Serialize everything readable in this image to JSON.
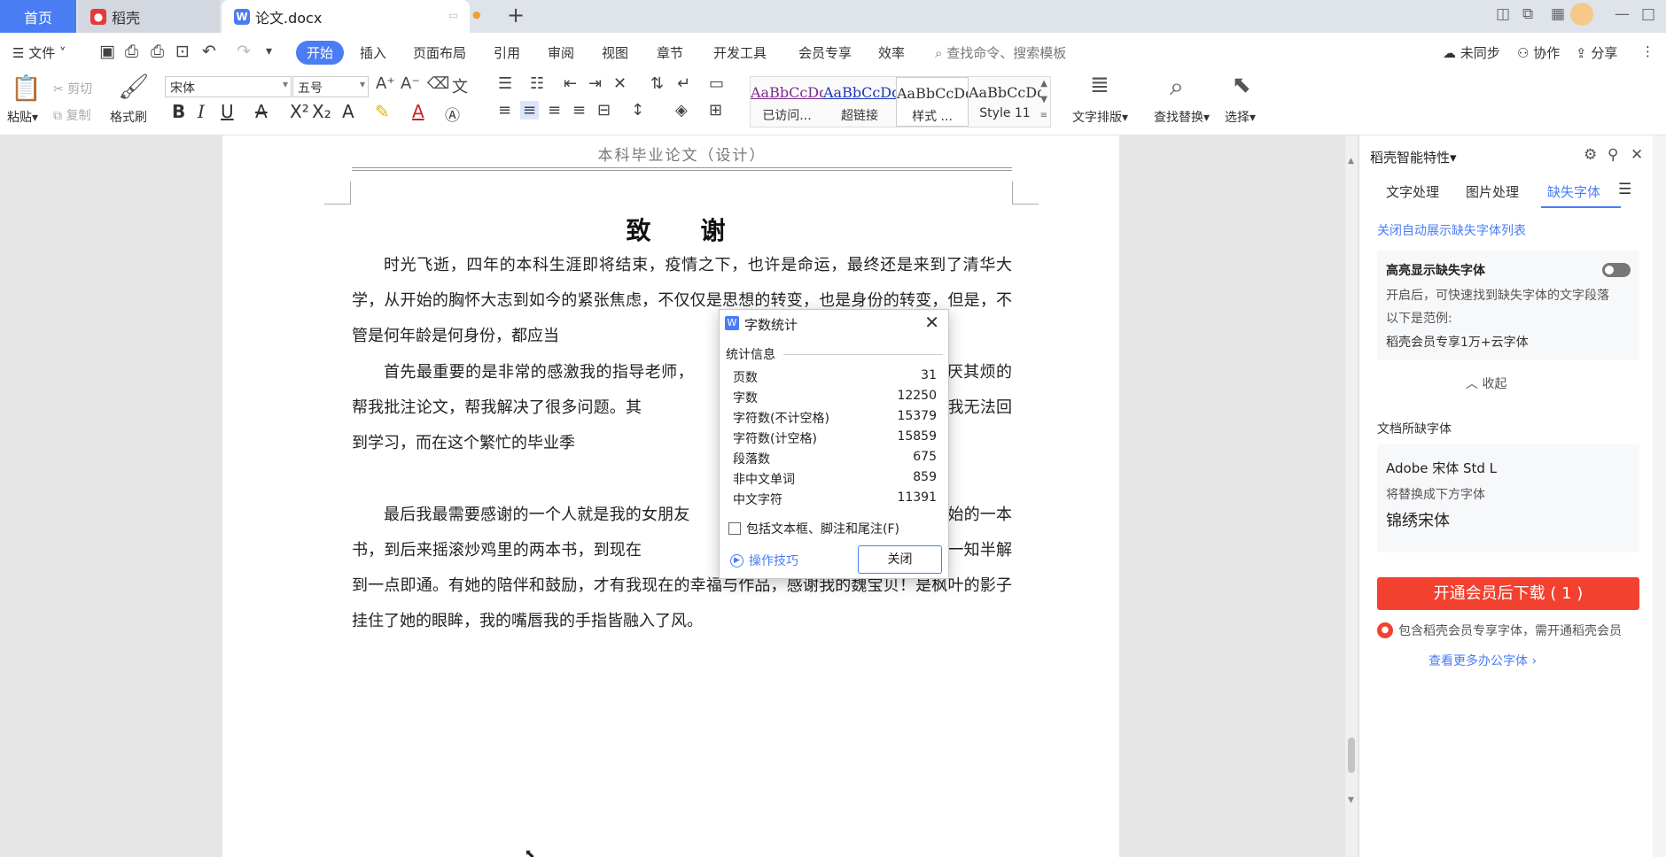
{
  "tabbar": {
    "home_label": "首页",
    "daoke_label": "稻壳",
    "doc_label": "论文.docx"
  },
  "menubar": {
    "file_label": "文件",
    "items": [
      "开始",
      "插入",
      "页面布局",
      "引用",
      "审阅",
      "视图",
      "章节",
      "开发工具",
      "会员专享",
      "效率"
    ],
    "search_placeholder": "查找命令、搜索模板",
    "sync_label": "未同步",
    "collab_label": "协作",
    "share_label": "分享"
  },
  "ribbon": {
    "paste": "粘贴",
    "cut": "剪切",
    "copy": "复制",
    "format_painter": "格式刷",
    "font_name": "宋体",
    "font_size": "五号",
    "style_gallery": [
      {
        "preview": "AaBbCcDd",
        "label": "已访问...",
        "color": "#7a2c8c"
      },
      {
        "preview": "AaBbCcDd",
        "label": "超链接",
        "color": "#1a37b8"
      },
      {
        "preview": "AaBbCcDd",
        "label": "样式 ...",
        "color": "#222222"
      },
      {
        "preview": "AaBbCcDd",
        "label": "Style 11",
        "color": "#222222"
      }
    ],
    "text_layout": "文字排版",
    "find_replace": "查找替换",
    "select": "选择"
  },
  "document": {
    "header": "本科毕业论文（设计）",
    "title": "致　谢",
    "paragraphs": [
      "时光飞逝，四年的本科生涯即将结束，疫情之下，也许是命运，最终还是来到了清华大学，从开始的胸怀大志到如今的紧张焦虑，不仅仅是思想的转变，也是身份的转变，但是，不管是何年龄是何身份，都应当",
      "首先最重要的是非常的感激我的指导老师，　　　　　　　　　　　　　义，不厌其烦的帮我批注论文，帮我解决了很多问题。其　　　　　　　　　　　　师，因为疫情，我无法回到学习，而在这个繁忙的毕业季　　　　　　　　　　　解决了很多繁琐的事情。",
      "最后我最需要感谢的一个人就是我的女朋友　　　　　　　　　　　　　从一开始的一本书，到后来摇滚炒鸡里的两本书，到现在　　　　　　　　　　　从相识到相知，从一知半解到一点即通。有她的陪伴和鼓励，才有我现在的幸福与作品，感谢我的魏宝贝！是枫叶的影子挂住了她的眼眸，我的嘴唇我的手指皆融入了风。"
    ]
  },
  "word_count_dialog": {
    "title": "字数统计",
    "section_label": "统计信息",
    "rows": [
      {
        "label": "页数",
        "value": "31"
      },
      {
        "label": "字数",
        "value": "12250"
      },
      {
        "label": "字符数(不计空格)",
        "value": "15379"
      },
      {
        "label": "字符数(计空格)",
        "value": "15859"
      },
      {
        "label": "段落数",
        "value": "675"
      },
      {
        "label": "非中文单词",
        "value": "859"
      },
      {
        "label": "中文字符",
        "value": "11391"
      }
    ],
    "checkbox_label": "包括文本框、脚注和尾注(F)",
    "tips_label": "操作技巧",
    "close_button": "关闭"
  },
  "side_panel": {
    "title": "稻壳智能特性",
    "tabs": [
      "文字处理",
      "图片处理",
      "缺失字体"
    ],
    "close_auto_link": "关闭自动展示缺失字体列表",
    "highlight_title": "高亮显示缺失字体",
    "highlight_desc": "开启后，可快速找到缺失字体的文字段落",
    "example_label": "以下是范例:",
    "example_value": "稻壳会员专享1万+云字体",
    "collapse_label": "收起",
    "missing_section": "文档所缺字体",
    "missing_font": "Adobe 宋体 Std L",
    "replace_label": "将替换成下方字体",
    "replace_font": "锦绣宋体",
    "vip_button": "开通会员后下载 ( 1 )",
    "vip_note": "包含稻壳会员专享字体，需开通稻壳会员",
    "more_link": "查看更多办公字体"
  },
  "colors": {
    "accent": "#4a7cf3",
    "vip_red": "#f2412f"
  }
}
